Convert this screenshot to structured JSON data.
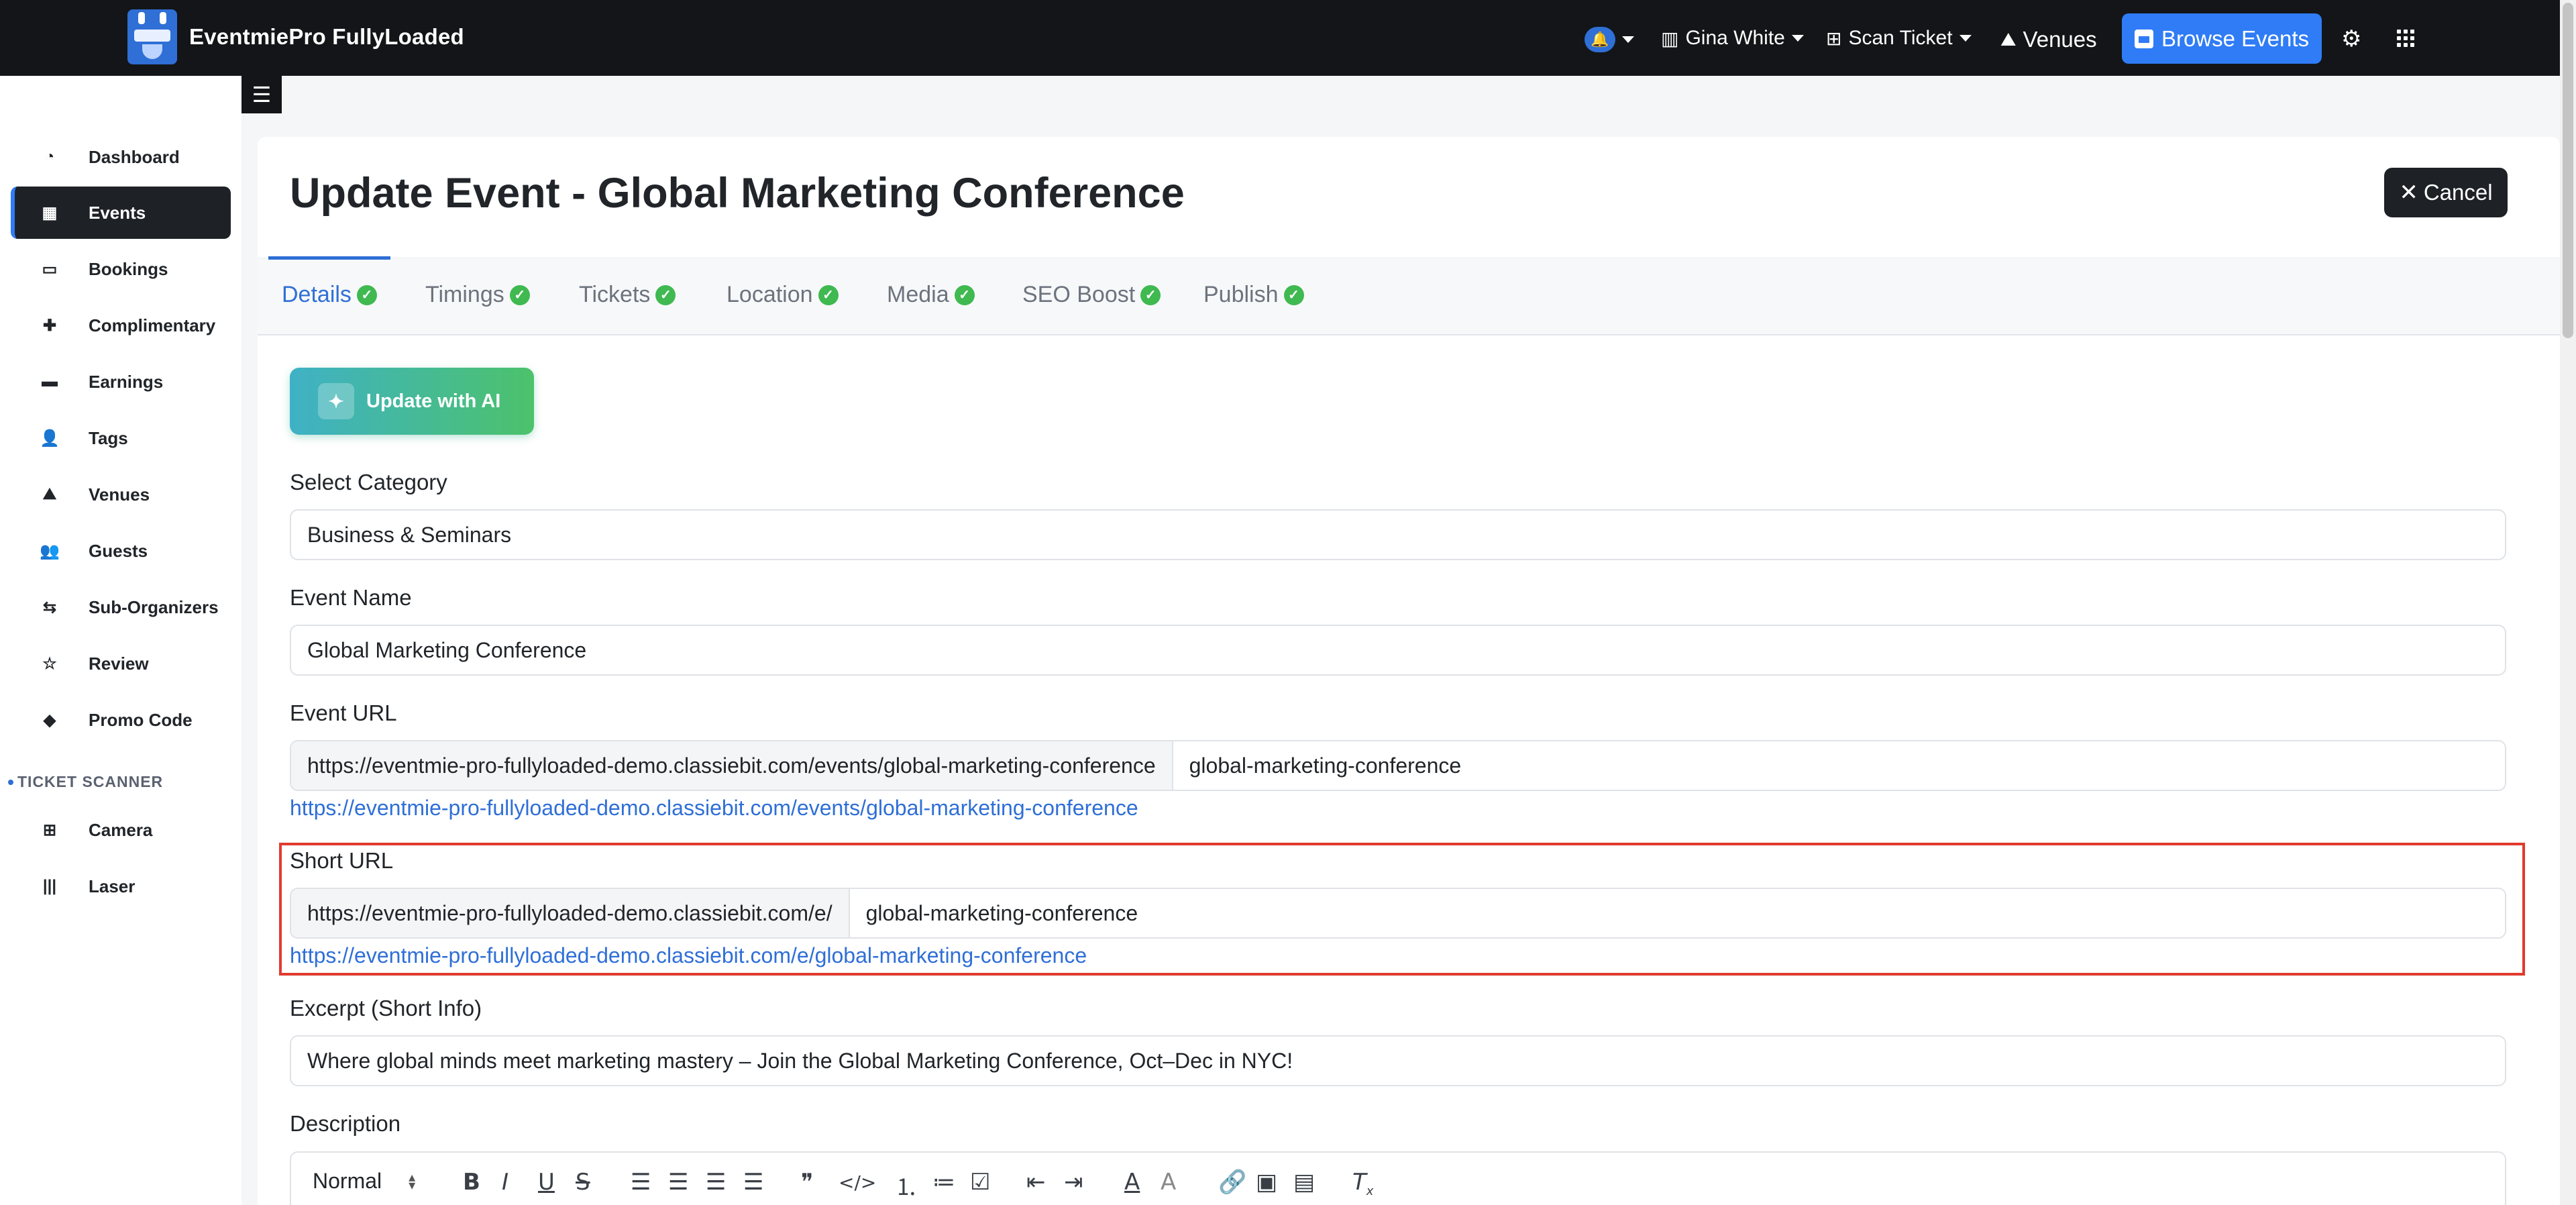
{
  "app": {
    "brand": "EventmiePro FullyLoaded"
  },
  "topnav": {
    "user": "Gina White",
    "scan_ticket": "Scan Ticket",
    "venues": "Venues",
    "browse_events": "Browse Events"
  },
  "sidebar": {
    "items": [
      {
        "label": "Dashboard",
        "icon": "dashboard-icon"
      },
      {
        "label": "Events",
        "icon": "calendar-icon",
        "active": true
      },
      {
        "label": "Bookings",
        "icon": "ticket-icon"
      },
      {
        "label": "Complimentary",
        "icon": "puzzle-icon"
      },
      {
        "label": "Earnings",
        "icon": "wallet-icon"
      },
      {
        "label": "Tags",
        "icon": "user-tag-icon"
      },
      {
        "label": "Venues",
        "icon": "map-icon"
      },
      {
        "label": "Guests",
        "icon": "users-icon"
      },
      {
        "label": "Sub-Organizers",
        "icon": "people-arrows-icon"
      },
      {
        "label": "Review",
        "icon": "star-icon"
      },
      {
        "label": "Promo Code",
        "icon": "tag-icon"
      }
    ],
    "section_title": "TICKET SCANNER",
    "scanner_items": [
      {
        "label": "Camera",
        "icon": "qrcode-icon"
      },
      {
        "label": "Laser",
        "icon": "barcode-icon"
      }
    ]
  },
  "page": {
    "title": "Update Event - Global Marketing Conference",
    "cancel": "Cancel"
  },
  "tabs": [
    {
      "label": "Details",
      "active": true
    },
    {
      "label": "Timings"
    },
    {
      "label": "Tickets"
    },
    {
      "label": "Location"
    },
    {
      "label": "Media"
    },
    {
      "label": "SEO Boost"
    },
    {
      "label": "Publish"
    }
  ],
  "form": {
    "ai_button": "Update with AI",
    "category_label": "Select Category",
    "category_value": "Business & Seminars",
    "event_name_label": "Event Name",
    "event_name_value": "Global Marketing Conference",
    "event_url_label": "Event URL",
    "event_url_prefix": "https://eventmie-pro-fullyloaded-demo.classiebit.com/events/global-marketing-conference",
    "event_url_slug": "global-marketing-conference",
    "event_url_link": "https://eventmie-pro-fullyloaded-demo.classiebit.com/events/global-marketing-conference",
    "short_url_label": "Short URL",
    "short_url_prefix": "https://eventmie-pro-fullyloaded-demo.classiebit.com/e/",
    "short_url_slug": "global-marketing-conference",
    "short_url_link": "https://eventmie-pro-fullyloaded-demo.classiebit.com/e/global-marketing-conference",
    "excerpt_label": "Excerpt (Short Info)",
    "excerpt_value": "Where global minds meet marketing mastery – Join the Global Marketing Conference, Oct–Dec in NYC!",
    "description_label": "Description",
    "editor_style": "Normal"
  },
  "colors": {
    "accent": "#2f6fd6",
    "check_green": "#3fb950",
    "highlight_red": "#e03a2e",
    "dark": "#131518"
  }
}
